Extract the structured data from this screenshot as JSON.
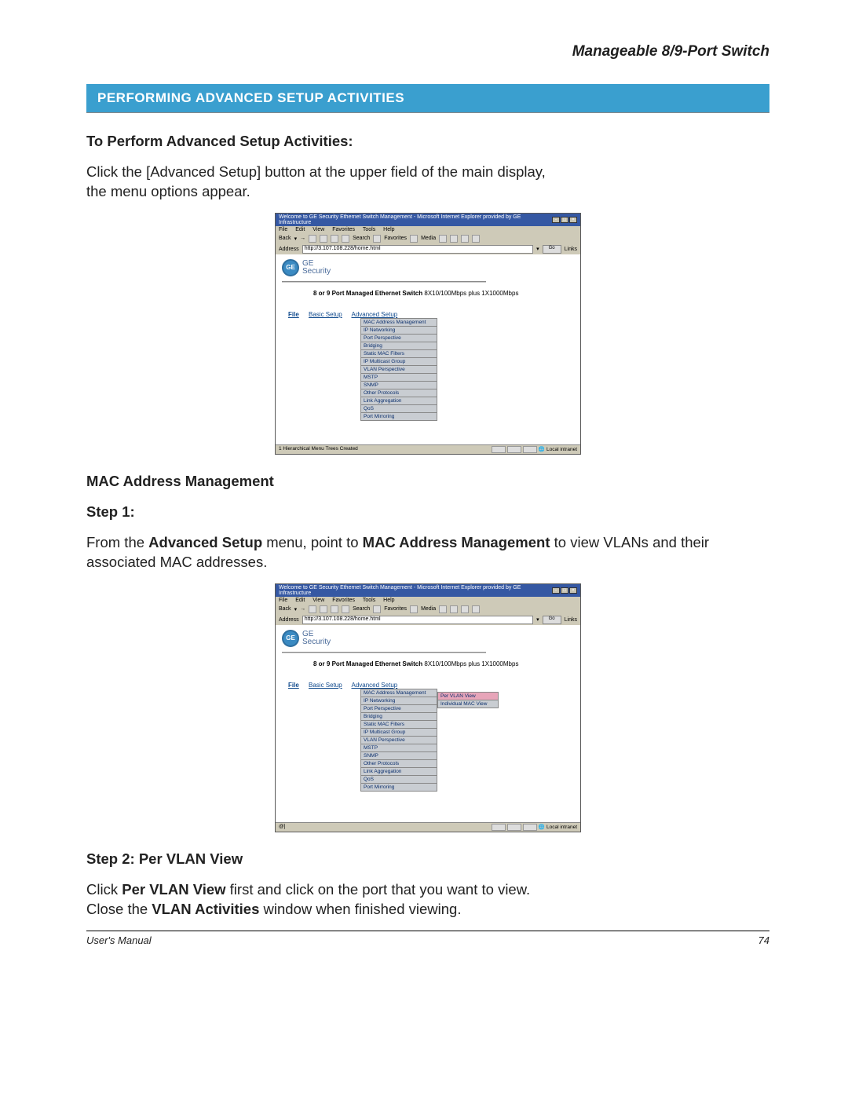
{
  "header": {
    "product": "Manageable 8/9-Port Switch"
  },
  "section": {
    "title": "PERFORMING ADVANCED SETUP ACTIVITIES"
  },
  "intro": {
    "heading": "To  Perform Advanced Setup Activities:",
    "line1": "Click the [Advanced Setup] button at the upper field of the main display,",
    "line2": "the menu options appear."
  },
  "mac_section": {
    "heading": "MAC Address Management",
    "step1_label": "Step 1:",
    "step1_text_a": "From the ",
    "step1_text_b": "Advanced Setup",
    "step1_text_c": " menu,  point to ",
    "step1_text_d": "MAC Address Management",
    "step1_text_e": " to view VLANs and their associated MAC addresses."
  },
  "step2": {
    "heading": "Step 2: Per VLAN View",
    "line1_a": "Click ",
    "line1_b": "Per VLAN View",
    "line1_c": " first and click on the port that you want to view.",
    "line2_a": "Close the ",
    "line2_b": "VLAN Activities",
    "line2_c": " window when finished viewing."
  },
  "footer": {
    "left": "User's Manual",
    "right": "74"
  },
  "mock": {
    "title": "Welcome to GE Security Ethernet Switch Management - Microsoft Internet Explorer provided by GE Infrastructure",
    "menus": {
      "file": "File",
      "edit": "Edit",
      "view": "View",
      "favorites": "Favorites",
      "tools": "Tools",
      "help": "Help"
    },
    "toolbar": {
      "back": "Back",
      "search": "Search",
      "favorites": "Favorites",
      "media": "Media"
    },
    "address_label": "Address",
    "address_value": "http://3.107.108.228/home.html",
    "go": "Go",
    "links": "Links",
    "brand_top": "GE",
    "brand_bottom": "Security",
    "switch_bold": "8 or 9 Port Managed Ethernet Switch",
    "switch_tail": "  8X10/100Mbps plus 1X1000Mbps",
    "tabs": {
      "file": "File",
      "basic": "Basic Setup",
      "advanced": "Advanced Setup"
    },
    "menu_items": [
      "MAC Address Management",
      "IP Networking",
      "Port Perspective",
      "Bridging",
      "Static MAC Filters",
      "IP Multicast Group",
      "VLAN Perspective",
      "MSTP",
      "SNMP",
      "Other Protocols",
      "Link Aggregation",
      "QoS",
      "Port Mirroring"
    ],
    "submenu_items": [
      "Per VLAN View",
      "Individual MAC View"
    ],
    "status_left1": "1 Hierarchical Menu Trees Created",
    "status_left2": "@]",
    "status_right": "Local intranet"
  }
}
